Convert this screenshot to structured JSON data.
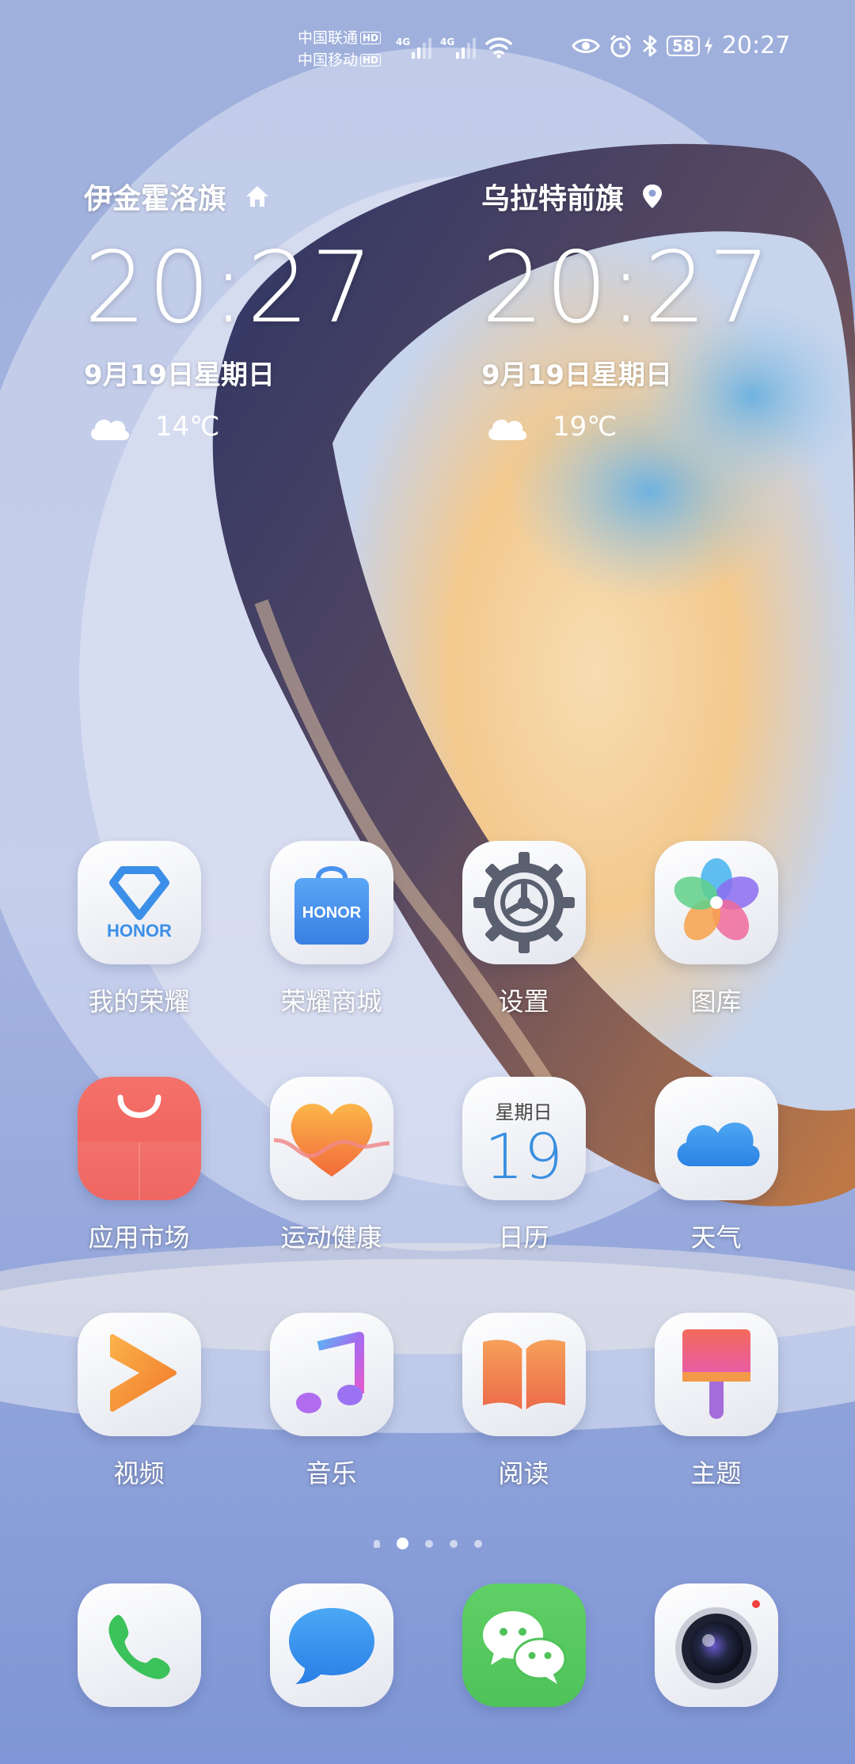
{
  "status_bar": {
    "carrier1": "中国联通",
    "carrier2": "中国移动",
    "hd_badge": "HD",
    "network1": "4G",
    "network2": "4G",
    "battery_level": "58",
    "time": "20:27"
  },
  "clocks": [
    {
      "city": "伊金霍洛旗",
      "city_icon": "home-icon",
      "time": "20:27",
      "date": "9月19日星期日",
      "weather_icon": "cloud-icon",
      "temperature": "14℃"
    },
    {
      "city": "乌拉特前旗",
      "city_icon": "location-pin-icon",
      "time": "20:27",
      "date": "9月19日星期日",
      "weather_icon": "cloud-icon",
      "temperature": "19℃"
    }
  ],
  "apps": {
    "row1": [
      {
        "label": "我的荣耀",
        "icon": "honor-diamond-icon",
        "icon_text": "HONOR"
      },
      {
        "label": "荣耀商城",
        "icon": "honor-store-bag-icon",
        "icon_text": "HONOR"
      },
      {
        "label": "设置",
        "icon": "gear-icon"
      },
      {
        "label": "图库",
        "icon": "gallery-flower-icon"
      }
    ],
    "row2": [
      {
        "label": "应用市场",
        "icon": "app-market-bag-icon"
      },
      {
        "label": "运动健康",
        "icon": "heart-icon"
      },
      {
        "label": "日历",
        "icon": "calendar-icon",
        "weekday": "星期日",
        "day": "19"
      },
      {
        "label": "天气",
        "icon": "cloud-icon"
      }
    ],
    "row3": [
      {
        "label": "视频",
        "icon": "video-play-icon"
      },
      {
        "label": "音乐",
        "icon": "music-note-icon"
      },
      {
        "label": "阅读",
        "icon": "book-icon"
      },
      {
        "label": "主题",
        "icon": "paint-brush-icon"
      }
    ]
  },
  "page_indicator": {
    "total_pages": 4,
    "active_page": 1
  },
  "dock": [
    {
      "name": "phone",
      "icon": "phone-icon"
    },
    {
      "name": "messages",
      "icon": "message-bubble-icon"
    },
    {
      "name": "wechat",
      "icon": "wechat-icon"
    },
    {
      "name": "camera",
      "icon": "camera-lens-icon"
    }
  ],
  "colors": {
    "accent_blue": "#3a8fe0",
    "market_red": "#f0605a",
    "wechat_green": "#56c75b",
    "phone_green": "#3cc25a",
    "message_blue": "#2f8ff0"
  }
}
